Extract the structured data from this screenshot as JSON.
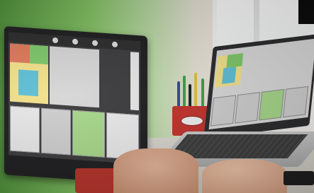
{
  "image": {
    "terminal_brand": "ISOBUS terminal",
    "colors": {
      "background_green": "#7fbe5f",
      "screen_yellow": "#f3e28a",
      "screen_cyan": "#5fc0d6",
      "pen_holder_red": "#c2312b"
    },
    "icons": [
      "isobus-terminal",
      "laptop",
      "pen-holder",
      "hand",
      "controller"
    ]
  }
}
